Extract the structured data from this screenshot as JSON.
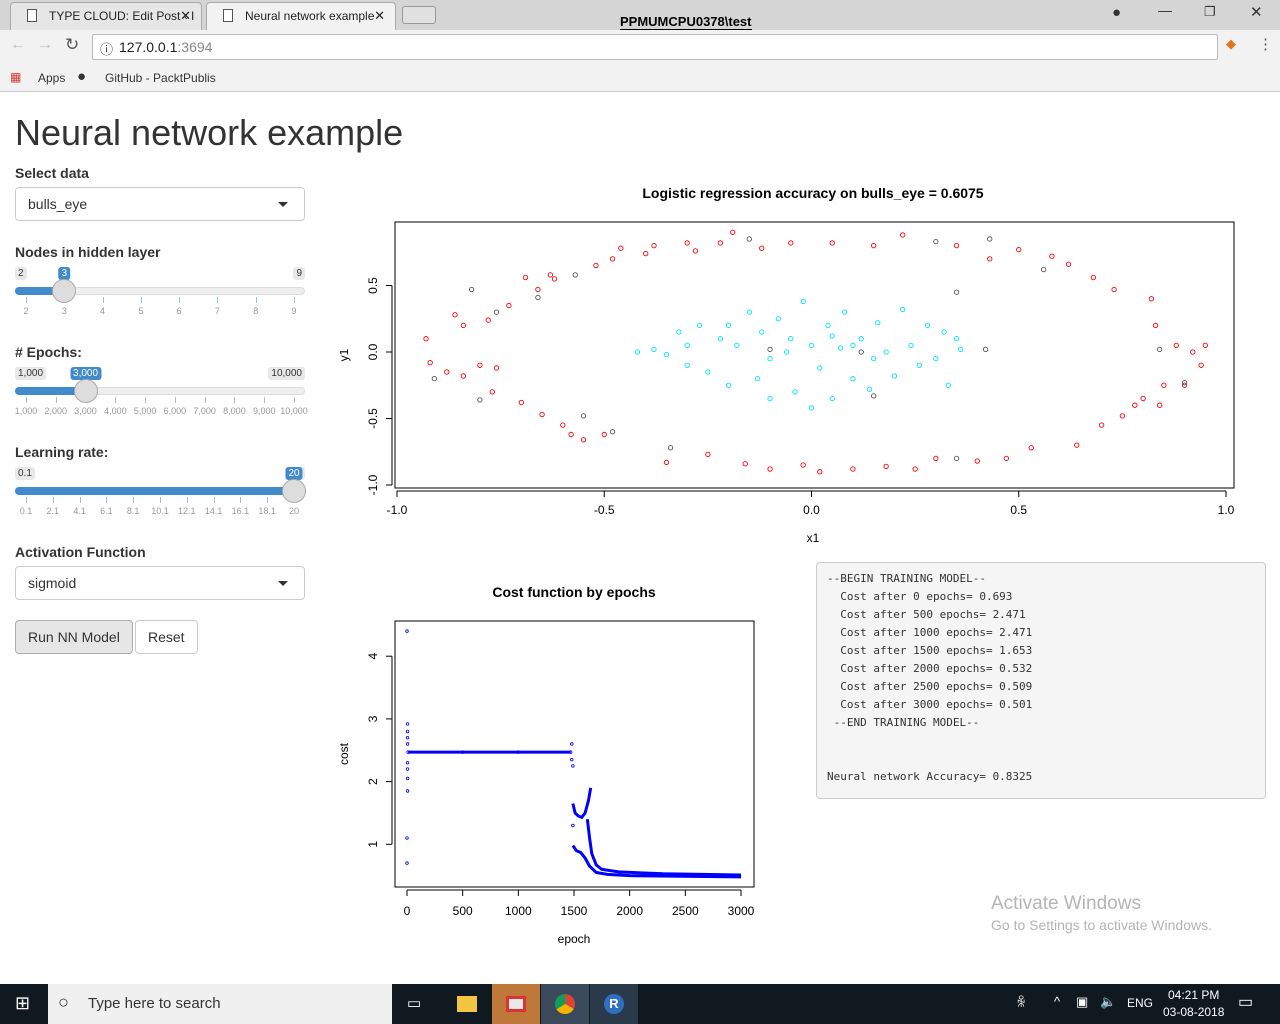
{
  "browser": {
    "tabs": [
      {
        "title": "TYPE CLOUD: Edit Post ‹ I"
      },
      {
        "title": "Neural network example"
      }
    ],
    "profile": "PPMUMCPU0378\\test",
    "url_host": "127.0.0.1",
    "url_port": ":3694",
    "bookmarks": [
      {
        "label": "Apps",
        "icon": "apps-grid-icon"
      },
      {
        "label": "GitHub - PacktPublis",
        "icon": "github-icon"
      }
    ]
  },
  "page": {
    "title": "Neural network example",
    "select_data": {
      "label": "Select data",
      "value": "bulls_eye"
    },
    "nodes": {
      "label": "Nodes in hidden layer",
      "min": "2",
      "max": "9",
      "value": "3",
      "fraction": 0.1429,
      "ticks": [
        "2",
        "3",
        "4",
        "5",
        "6",
        "7",
        "8",
        "9"
      ]
    },
    "epochs": {
      "label": "# Epochs:",
      "min": "1,000",
      "max": "10,000",
      "value": "3,000",
      "fraction": 0.2222,
      "ticks": [
        "1,000",
        "2,000",
        "3,000",
        "4,000",
        "5,000",
        "6,000",
        "7,000",
        "8,000",
        "9,000",
        "10,000"
      ]
    },
    "learning_rate": {
      "label": "Learning rate:",
      "min": "0.1",
      "max": "20",
      "value": "20",
      "fraction": 1.0,
      "ticks": [
        "0.1",
        "2.1",
        "4.1",
        "6.1",
        "8.1",
        "10.1",
        "12.1",
        "14.1",
        "16.1",
        "18.1",
        "20"
      ]
    },
    "activation": {
      "label": "Activation Function",
      "value": "sigmoid"
    },
    "run_button": "Run NN Model",
    "reset_button": "Reset",
    "output": "--BEGIN TRAINING MODEL--\n  Cost after 0 epochs= 0.693\n  Cost after 500 epochs= 2.471\n  Cost after 1000 epochs= 2.471\n  Cost after 1500 epochs= 1.653\n  Cost after 2000 epochs= 0.532\n  Cost after 2500 epochs= 0.509\n  Cost after 3000 epochs= 0.501\n --END TRAINING MODEL--\n\n\nNeural network Accuracy= 0.8325"
  },
  "chart_data": [
    {
      "type": "scatter",
      "title": "Logistic regression accuracy on bulls_eye = 0.6075",
      "xlabel": "x1",
      "ylabel": "y1",
      "xlim": [
        -1.0,
        1.0
      ],
      "ylim": [
        -1.0,
        0.9
      ],
      "xticks": [
        "-1.0",
        "-0.5",
        "0.0",
        "0.5",
        "1.0"
      ],
      "yticks": [
        "-1.0",
        "-0.5",
        "0.0",
        "0.5"
      ],
      "colors": {
        "outer": "#ff0000",
        "inner": "#00e5ee",
        "misc": "#555555"
      },
      "series": [
        {
          "class": "outer",
          "points": [
            [
              -0.93,
              0.1
            ],
            [
              -0.92,
              -0.08
            ],
            [
              -0.88,
              -0.15
            ],
            [
              -0.86,
              0.28
            ],
            [
              -0.84,
              0.2
            ],
            [
              -0.84,
              -0.18
            ],
            [
              -0.8,
              -0.1
            ],
            [
              -0.78,
              0.24
            ],
            [
              -0.77,
              -0.3
            ],
            [
              -0.76,
              -0.12
            ],
            [
              -0.73,
              0.35
            ],
            [
              -0.7,
              -0.38
            ],
            [
              -0.69,
              0.56
            ],
            [
              -0.66,
              0.47
            ],
            [
              -0.65,
              -0.47
            ],
            [
              -0.63,
              0.58
            ],
            [
              -0.62,
              0.55
            ],
            [
              -0.6,
              -0.55
            ],
            [
              -0.58,
              -0.62
            ],
            [
              -0.55,
              -0.66
            ],
            [
              -0.52,
              0.65
            ],
            [
              -0.5,
              -0.62
            ],
            [
              -0.48,
              0.7
            ],
            [
              -0.46,
              0.78
            ],
            [
              -0.4,
              0.74
            ],
            [
              -0.38,
              0.8
            ],
            [
              -0.35,
              -0.83
            ],
            [
              -0.3,
              0.82
            ],
            [
              -0.28,
              0.76
            ],
            [
              -0.25,
              -0.77
            ],
            [
              -0.22,
              0.82
            ],
            [
              -0.19,
              0.9
            ],
            [
              -0.16,
              -0.84
            ],
            [
              -0.12,
              0.78
            ],
            [
              -0.1,
              -0.88
            ],
            [
              -0.05,
              0.82
            ],
            [
              -0.02,
              -0.85
            ],
            [
              0.02,
              -0.9
            ],
            [
              0.05,
              0.82
            ],
            [
              0.1,
              -0.88
            ],
            [
              0.15,
              0.8
            ],
            [
              0.18,
              -0.86
            ],
            [
              0.22,
              0.88
            ],
            [
              0.25,
              -0.88
            ],
            [
              0.3,
              -0.8
            ],
            [
              0.35,
              0.8
            ],
            [
              0.4,
              -0.82
            ],
            [
              0.43,
              0.7
            ],
            [
              0.47,
              -0.8
            ],
            [
              0.5,
              0.77
            ],
            [
              0.53,
              -0.72
            ],
            [
              0.58,
              0.72
            ],
            [
              0.62,
              0.66
            ],
            [
              0.64,
              -0.7
            ],
            [
              0.68,
              0.56
            ],
            [
              0.7,
              -0.55
            ],
            [
              0.73,
              0.47
            ],
            [
              0.75,
              -0.48
            ],
            [
              0.78,
              -0.4
            ],
            [
              0.8,
              -0.35
            ],
            [
              0.82,
              0.4
            ],
            [
              0.83,
              0.2
            ],
            [
              0.84,
              -0.4
            ],
            [
              0.85,
              -0.25
            ],
            [
              0.88,
              0.05
            ],
            [
              0.9,
              -0.25
            ],
            [
              0.92,
              0.0
            ],
            [
              0.94,
              -0.1
            ],
            [
              0.95,
              0.05
            ]
          ]
        },
        {
          "class": "inner",
          "points": [
            [
              -0.42,
              0.0
            ],
            [
              -0.38,
              0.02
            ],
            [
              -0.35,
              -0.02
            ],
            [
              -0.32,
              0.15
            ],
            [
              -0.3,
              -0.1
            ],
            [
              -0.27,
              0.2
            ],
            [
              -0.25,
              -0.15
            ],
            [
              -0.22,
              0.1
            ],
            [
              -0.2,
              -0.25
            ],
            [
              -0.18,
              0.05
            ],
            [
              -0.15,
              0.3
            ],
            [
              -0.13,
              -0.2
            ],
            [
              -0.12,
              0.15
            ],
            [
              -0.1,
              -0.35
            ],
            [
              -0.08,
              0.25
            ],
            [
              -0.06,
              0.0
            ],
            [
              -0.04,
              -0.3
            ],
            [
              -0.02,
              0.38
            ],
            [
              0.0,
              0.05
            ],
            [
              0.0,
              -0.42
            ],
            [
              0.02,
              -0.12
            ],
            [
              0.04,
              0.2
            ],
            [
              0.05,
              -0.35
            ],
            [
              0.07,
              0.03
            ],
            [
              0.08,
              0.3
            ],
            [
              0.1,
              -0.2
            ],
            [
              0.12,
              0.1
            ],
            [
              0.14,
              -0.28
            ],
            [
              0.16,
              0.22
            ],
            [
              0.18,
              0.0
            ],
            [
              0.2,
              -0.18
            ],
            [
              0.22,
              0.32
            ],
            [
              0.24,
              0.05
            ],
            [
              0.26,
              -0.1
            ],
            [
              0.28,
              0.2
            ],
            [
              0.3,
              -0.05
            ],
            [
              0.32,
              0.15
            ],
            [
              0.33,
              -0.25
            ],
            [
              0.35,
              0.1
            ],
            [
              0.36,
              0.02
            ],
            [
              -0.3,
              0.05
            ],
            [
              0.1,
              0.05
            ],
            [
              -0.05,
              0.1
            ],
            [
              0.15,
              -0.05
            ],
            [
              -0.2,
              0.2
            ],
            [
              0.05,
              0.12
            ],
            [
              -0.1,
              -0.05
            ]
          ]
        },
        {
          "class": "misc",
          "points": [
            [
              -0.91,
              -0.2
            ],
            [
              -0.82,
              0.47
            ],
            [
              -0.8,
              -0.36
            ],
            [
              -0.76,
              0.3
            ],
            [
              -0.66,
              0.41
            ],
            [
              -0.57,
              0.58
            ],
            [
              -0.55,
              -0.48
            ],
            [
              -0.48,
              -0.6
            ],
            [
              -0.34,
              -0.72
            ],
            [
              -0.15,
              0.85
            ],
            [
              -0.1,
              0.02
            ],
            [
              0.12,
              0.0
            ],
            [
              0.15,
              -0.33
            ],
            [
              0.3,
              0.83
            ],
            [
              0.35,
              -0.8
            ],
            [
              0.43,
              0.85
            ],
            [
              0.56,
              0.62
            ],
            [
              0.42,
              0.02
            ],
            [
              0.84,
              0.02
            ],
            [
              0.9,
              -0.23
            ],
            [
              0.35,
              0.45
            ]
          ]
        }
      ]
    },
    {
      "type": "scatter",
      "title": "Cost function by epochs",
      "xlabel": "epoch",
      "ylabel": "cost",
      "xlim": [
        0,
        3000
      ],
      "ylim": [
        0.3,
        4.5
      ],
      "xticks": [
        "0",
        "500",
        "1000",
        "1500",
        "2000",
        "2500",
        "3000"
      ],
      "yticks": [
        "1",
        "2",
        "3",
        "4"
      ],
      "color": "#0000ff",
      "series": [
        {
          "points": [
            [
              0,
              4.4
            ],
            [
              0,
              1.1
            ],
            [
              0,
              0.7
            ],
            [
              5,
              1.85
            ],
            [
              5,
              2.05
            ],
            [
              5,
              2.2
            ],
            [
              5,
              2.3
            ],
            [
              5,
              2.6
            ],
            [
              5,
              2.7
            ],
            [
              5,
              2.8
            ],
            [
              5,
              2.92
            ],
            [
              10,
              2.47
            ],
            [
              500,
              2.47
            ],
            [
              1000,
              2.47
            ],
            [
              1470,
              2.47
            ],
            [
              1480,
              2.6
            ],
            [
              1480,
              2.35
            ],
            [
              1490,
              2.25
            ],
            [
              1490,
              1.3
            ]
          ]
        },
        {
          "points": [
            [
              1490,
              1.65
            ],
            [
              1510,
              1.5
            ],
            [
              1540,
              1.45
            ],
            [
              1570,
              1.43
            ],
            [
              1600,
              1.5
            ],
            [
              1630,
              1.7
            ],
            [
              1650,
              1.9
            ]
          ]
        },
        {
          "points": [
            [
              1490,
              0.98
            ],
            [
              1520,
              0.9
            ],
            [
              1560,
              0.87
            ],
            [
              1600,
              0.78
            ],
            [
              1640,
              0.65
            ],
            [
              1700,
              0.55
            ],
            [
              1800,
              0.52
            ],
            [
              2000,
              0.5
            ],
            [
              3000,
              0.48
            ]
          ]
        },
        {
          "points": [
            [
              1620,
              1.4
            ],
            [
              1640,
              1.1
            ],
            [
              1660,
              0.85
            ],
            [
              1700,
              0.67
            ],
            [
              1750,
              0.6
            ],
            [
              1900,
              0.56
            ],
            [
              2300,
              0.53
            ],
            [
              3000,
              0.51
            ]
          ]
        }
      ]
    }
  ],
  "watermark": {
    "line1": "Activate Windows",
    "line2": "Go to Settings to activate Windows."
  },
  "taskbar": {
    "search_placeholder": "Type here to search",
    "time": "04:21 PM",
    "date": "03-08-2018",
    "lang": "ENG"
  }
}
